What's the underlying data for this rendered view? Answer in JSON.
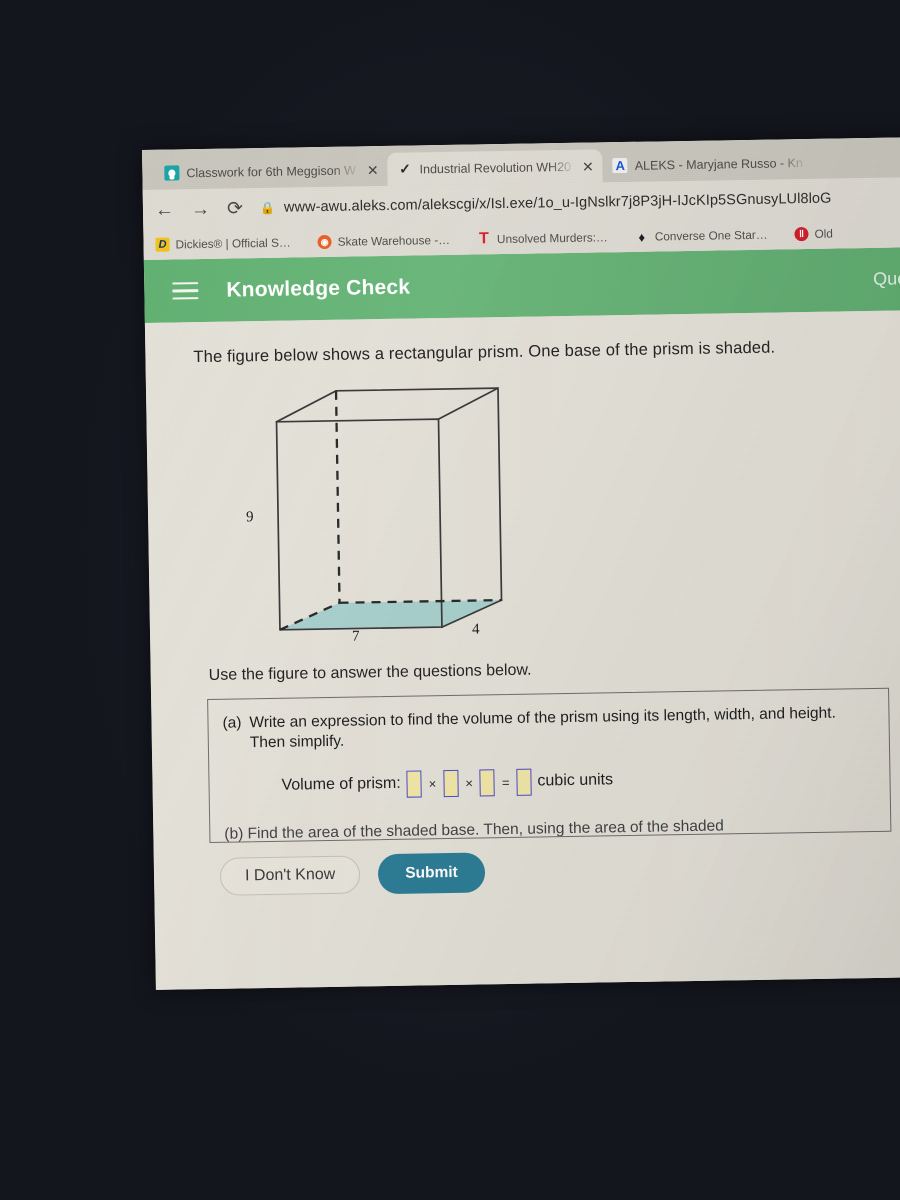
{
  "browser": {
    "tabs": [
      {
        "title": "Classwork for 6th Meggison W",
        "icon": "classroom-icon",
        "close": "✕",
        "active": false
      },
      {
        "title": "Industrial Revolution WH20",
        "icon": "check-circle-icon",
        "close": "✕",
        "active": true
      },
      {
        "title": "ALEKS - Maryjane Russo - Kn",
        "icon": "aleks-a-icon",
        "close": "",
        "active": false
      }
    ],
    "nav": {
      "back_icon": "←",
      "forward_icon": "→",
      "reload_icon": "⟳",
      "lock_icon": "🔒"
    },
    "url": "www-awu.aleks.com/alekscgi/x/Isl.exe/1o_u-IgNslkr7j8P3jH-IJcKIp5SGnusyLUl8loG",
    "bookmarks": [
      {
        "label": "Dickies® | Official S…",
        "icon": "dickies-icon",
        "glyph": "D"
      },
      {
        "label": "Skate Warehouse -…",
        "icon": "skate-warehouse-icon",
        "glyph": "◉"
      },
      {
        "label": "Unsolved Murders:…",
        "icon": "tee-icon",
        "glyph": "T"
      },
      {
        "label": "Converse One Star…",
        "icon": "converse-star-icon",
        "glyph": "♦"
      },
      {
        "label": "Old",
        "icon": "old-navy-icon",
        "glyph": "‖"
      }
    ]
  },
  "app": {
    "menu_icon": "hamburger-icon",
    "title": "Knowledge Check",
    "question_label": "Ques",
    "header_color": "#67b277"
  },
  "content": {
    "prompt": "The figure below shows a rectangular prism. One base of the prism is shaded.",
    "subprompt": "Use the figure to answer the questions below.",
    "part_a": {
      "letter": "(a)",
      "text": "Write an expression to find the volume of the prism using its length, width, and height. Then simplify.",
      "answer_label": "Volume of prism:",
      "operator1": "×",
      "operator2": "×",
      "equals": "=",
      "unit": "cubic units",
      "inputs": [
        "",
        "",
        "",
        ""
      ]
    },
    "part_b": {
      "text": "(b)  Find the area of the shaded base. Then, using the area of the shaded"
    }
  },
  "buttons": {
    "dont_know": "I Don't Know",
    "submit": "Submit",
    "submit_color": "#2d7d96"
  },
  "chart_data": {
    "type": "diagram",
    "shape": "rectangular prism",
    "title": "Rectangular prism with shaded base",
    "labels": {
      "height": "9",
      "length": "7",
      "width": "4"
    },
    "dimensions": {
      "height": 9,
      "length": 7,
      "width": 4
    },
    "shaded_face": "bottom base",
    "shaded_color": "#a9d0cd",
    "edge_color": "#3a3a3a",
    "hidden_edges": "dashed"
  }
}
